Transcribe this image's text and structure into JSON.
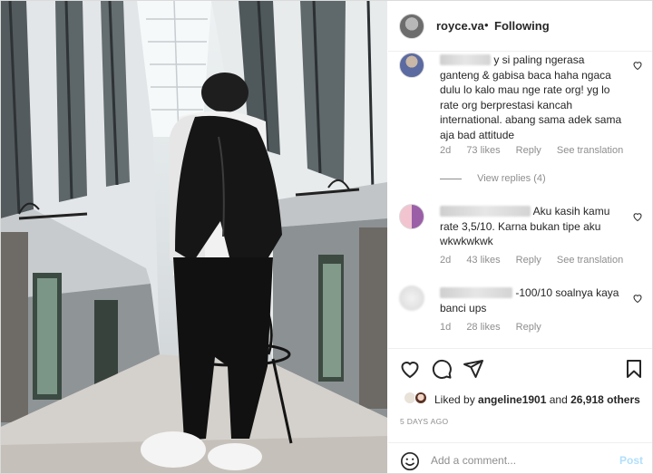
{
  "header": {
    "username": "royce.va",
    "separator": "•",
    "follow_status": "Following"
  },
  "comments": [
    {
      "text": "y si paling ngerasa ganteng & gabisa baca haha ngaca dulu lo kalo mau nge rate org! yg lo rate org berprestasi kancah international. abang sama adek sama aja bad attitude",
      "time": "2d",
      "likes": "73 likes",
      "reply": "Reply",
      "translate": "See translation",
      "view_replies": "View replies (4)"
    },
    {
      "text": "Aku kasih kamu rate 3,5/10. Karna bukan tipe aku wkwkwkwk",
      "time": "2d",
      "likes": "43 likes",
      "reply": "Reply",
      "translate": "See translation"
    },
    {
      "text": "-100/10 soalnya kaya banci ups",
      "time": "1d",
      "likes": "28 likes",
      "reply": "Reply"
    }
  ],
  "likes": {
    "prefix": "Liked by ",
    "user": "angeline1901",
    "middle": " and ",
    "others": "26,918 others"
  },
  "timestamp": "5 DAYS AGO",
  "add_comment": {
    "placeholder": "Add a comment...",
    "post_label": "Post"
  },
  "icons": {
    "like": "heart-icon",
    "comment": "speech-bubble-icon",
    "share": "paper-plane-icon",
    "save": "bookmark-icon",
    "emoji": "smiley-icon"
  },
  "colors": {
    "text": "#262626",
    "secondary": "#8e8e8e",
    "post_button": "#b2dffc",
    "border": "#dbdbdb"
  }
}
